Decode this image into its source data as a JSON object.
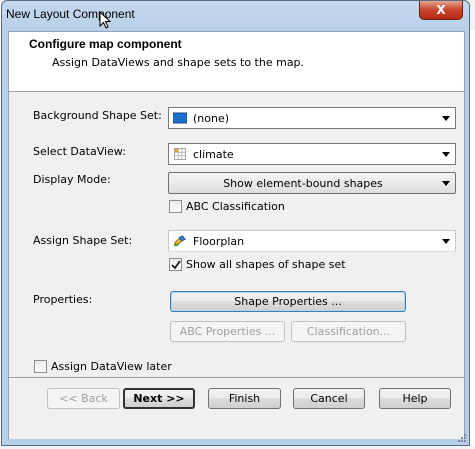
{
  "window": {
    "title": "New Layout Component",
    "close_symbol": "X"
  },
  "header": {
    "title": "Configure map component",
    "subtitle": "Assign DataViews and shape sets to the map."
  },
  "form": {
    "background_label": "Background Shape Set:",
    "background_value": "(none)",
    "dataview_label": "Select DataView:",
    "dataview_value": "climate",
    "display_mode_label": "Display Mode:",
    "display_mode_value": "Show element-bound shapes",
    "abc_classification_label": "ABC Classification",
    "abc_classification_checked": false,
    "shape_set_label": "Assign Shape Set:",
    "shape_set_value": "Floorplan",
    "show_all_shapes_label": "Show all shapes of shape set",
    "show_all_shapes_checked": true,
    "properties_label": "Properties:",
    "shape_properties_button": "Shape Properties ...",
    "abc_properties_button": "ABC Properties ...",
    "classification_button": "Classification...",
    "assign_later_label": "Assign DataView later",
    "assign_later_checked": false
  },
  "footer": {
    "back": "<< Back",
    "next": "Next >>",
    "finish": "Finish",
    "cancel": "Cancel",
    "help": "Help"
  },
  "colors": {
    "shape_swatch": "#1e6fc8",
    "close_red": "#c7432b"
  }
}
